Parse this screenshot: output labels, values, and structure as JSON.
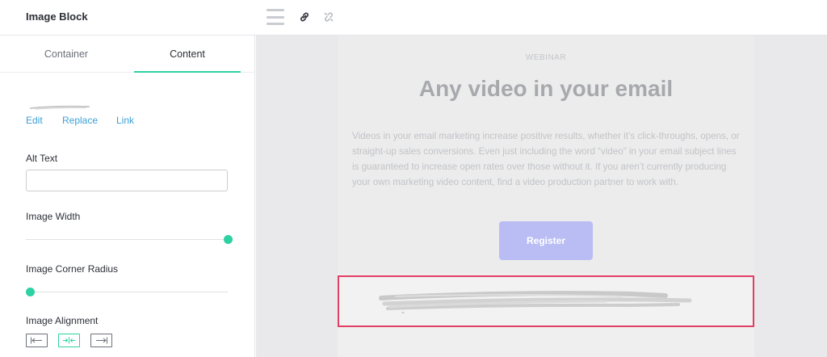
{
  "topbar": {
    "title": "Image Block",
    "icons": [
      "hamburger-menu-icon",
      "link-icon",
      "unlink-icon"
    ]
  },
  "sidebar": {
    "tabs": [
      {
        "label": "Container",
        "active": false
      },
      {
        "label": "Content",
        "active": true
      }
    ],
    "image_actions": {
      "edit": "Edit",
      "replace": "Replace",
      "link": "Link"
    },
    "alt_text": {
      "label": "Alt Text",
      "value": "",
      "placeholder": ""
    },
    "image_width": {
      "label": "Image Width",
      "value_percent": 100
    },
    "corner_radius": {
      "label": "Image Corner Radius",
      "value_percent": 0
    },
    "alignment": {
      "label": "Image Alignment",
      "options": [
        "align-left-icon",
        "align-center-icon",
        "align-right-icon"
      ],
      "selected": "center"
    }
  },
  "email": {
    "eyebrow": "WEBINAR",
    "headline": "Any video in your email",
    "body": "Videos in your email marketing increase positive results, whether it’s click-throughs, opens, or straight-up sales conversions. Even just including the word “video” in your email subject lines is guaranteed to increase open rates over those without it. If you aren’t currently producing your own marketing video content, find a video production partner to work with.",
    "cta_label": "Register"
  },
  "colors": {
    "accent": "#2ed1a2",
    "link": "#3aa0d8",
    "selection_border": "#e23e64",
    "button": "#b9bdf4"
  }
}
